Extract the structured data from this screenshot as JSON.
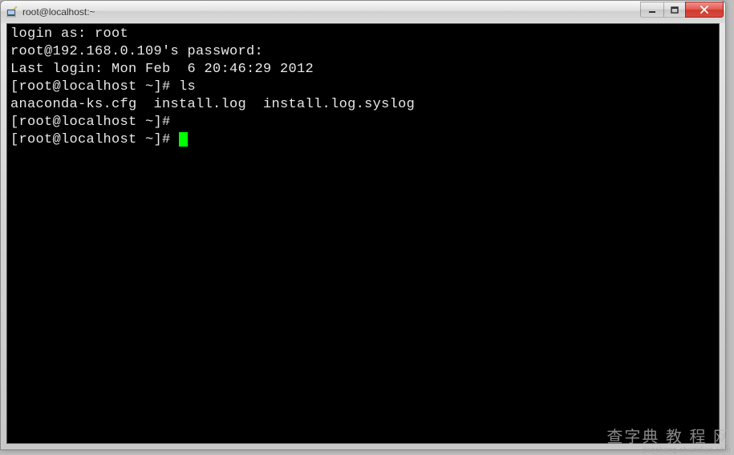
{
  "window": {
    "title": "root@localhost:~"
  },
  "terminal": {
    "lines": [
      "login as: root",
      "root@192.168.0.109's password:",
      "Last login: Mon Feb  6 20:46:29 2012",
      "[root@localhost ~]# ls",
      "anaconda-ks.cfg  install.log  install.log.syslog",
      "[root@localhost ~]#",
      "[root@localhost ~]# "
    ]
  },
  "watermark": {
    "main": "查字典 教 程 网",
    "sub": "jiaocheng.chazidian.com"
  }
}
